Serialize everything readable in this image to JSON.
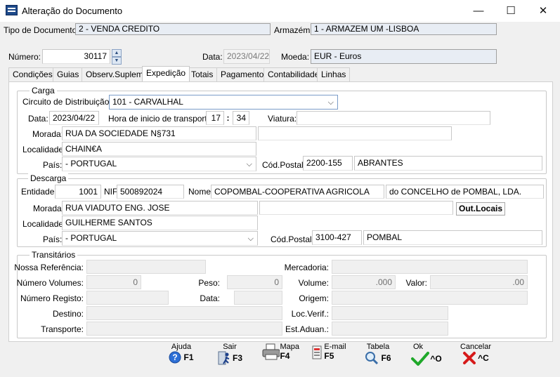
{
  "window": {
    "title": "Alteração do Documento",
    "minimize": "—",
    "maximize": "☐",
    "close": "✕"
  },
  "header": {
    "tipo_label": "Tipo de Documento:",
    "tipo_value": "2 - VENDA CREDITO",
    "armazem_label": "Armazém:",
    "armazem_value": "1 - ARMAZEM UM -LISBOA",
    "numero_label": "Número:",
    "numero_value": "30117",
    "data_label": "Data:",
    "data_value": "2023/04/22",
    "moeda_label": "Moeda:",
    "moeda_value": "EUR - Euros"
  },
  "tabs": [
    "Condições",
    "Guias",
    "Observ.Suplem.",
    "Expedição",
    "Totais",
    "Pagamento",
    "Contabilidade",
    "Linhas"
  ],
  "carga": {
    "title": "Carga",
    "circuito_label": "Circuito de Distribuição:",
    "circuito_value": "101 - CARVALHAL",
    "data_label": "Data:",
    "data_value": "2023/04/22",
    "hora_label": "Hora de inicio de transporte:",
    "hora_h": "17",
    "hora_sep": ":",
    "hora_m": "34",
    "viatura_label": "Viatura:",
    "viatura_value": "",
    "morada_label": "Morada:",
    "morada_value": "RUA DA SOCIEDADE N§731",
    "morada2_value": "",
    "localidade_label": "Localidade:",
    "localidade_value": "CHAIN€A",
    "pais_label": "País:",
    "pais_value": " - PORTUGAL",
    "cod_postal_label": "Cód.Postal:",
    "cod_postal_value": "2200-155",
    "cidade_value": "ABRANTES"
  },
  "descarga": {
    "title": "Descarga",
    "entidade_label": "Entidade:",
    "entidade_value": "1001",
    "nif_label": "NIF",
    "nif_value": "500892024",
    "nome_label": "Nome:",
    "nome_value": "COPOMBAL-COOPERATIVA AGRICOLA",
    "nome2_value": "do CONCELHO de POMBAL, LDA.",
    "morada_label": "Morada:",
    "morada_value": "RUA VIADUTO ENG. JOSE",
    "morada2_value": "",
    "out_locais_label": "Out.Locais",
    "localidade_label": "Localidade:",
    "localidade_value": "GUILHERME SANTOS",
    "pais_label": "País:",
    "pais_value": " - PORTUGAL",
    "cod_postal_label": "Cód.Postal:",
    "cod_postal_value": "3100-427",
    "cidade_value": "POMBAL"
  },
  "transitarios": {
    "title": "Transitários",
    "nossa_ref_label": "Nossa Referência:",
    "mercadoria_label": "Mercadoria:",
    "num_volumes_label": "Número Volumes:",
    "num_volumes_value": "0",
    "peso_label": "Peso:",
    "peso_value": "0",
    "volume_label": "Volume:",
    "volume_value": ".000",
    "valor_label": "Valor:",
    "valor_value": ".00",
    "num_registo_label": "Número Registo:",
    "data_label": "Data:",
    "origem_label": "Origem:",
    "destino_label": "Destino:",
    "loc_verif_label": "Loc.Verif.:",
    "transporte_label": "Transporte:",
    "est_aduan_label": "Est.Aduan.:"
  },
  "toolbar": [
    {
      "caption": "Ajuda",
      "key": "F1",
      "icon": "help-icon"
    },
    {
      "caption": "Sair",
      "key": "F3",
      "icon": "exit-icon"
    },
    {
      "caption": "Mapa",
      "key": "F4",
      "icon": "printer-icon"
    },
    {
      "caption": "E-mail",
      "key": "F5",
      "icon": "email-icon"
    },
    {
      "caption": "Tabela",
      "key": "F6",
      "icon": "magnifier-icon"
    },
    {
      "caption": "Ok",
      "key": "^O",
      "icon": "checkmark-icon"
    },
    {
      "caption": "Cancelar",
      "key": "^C",
      "icon": "cancel-icon"
    }
  ]
}
